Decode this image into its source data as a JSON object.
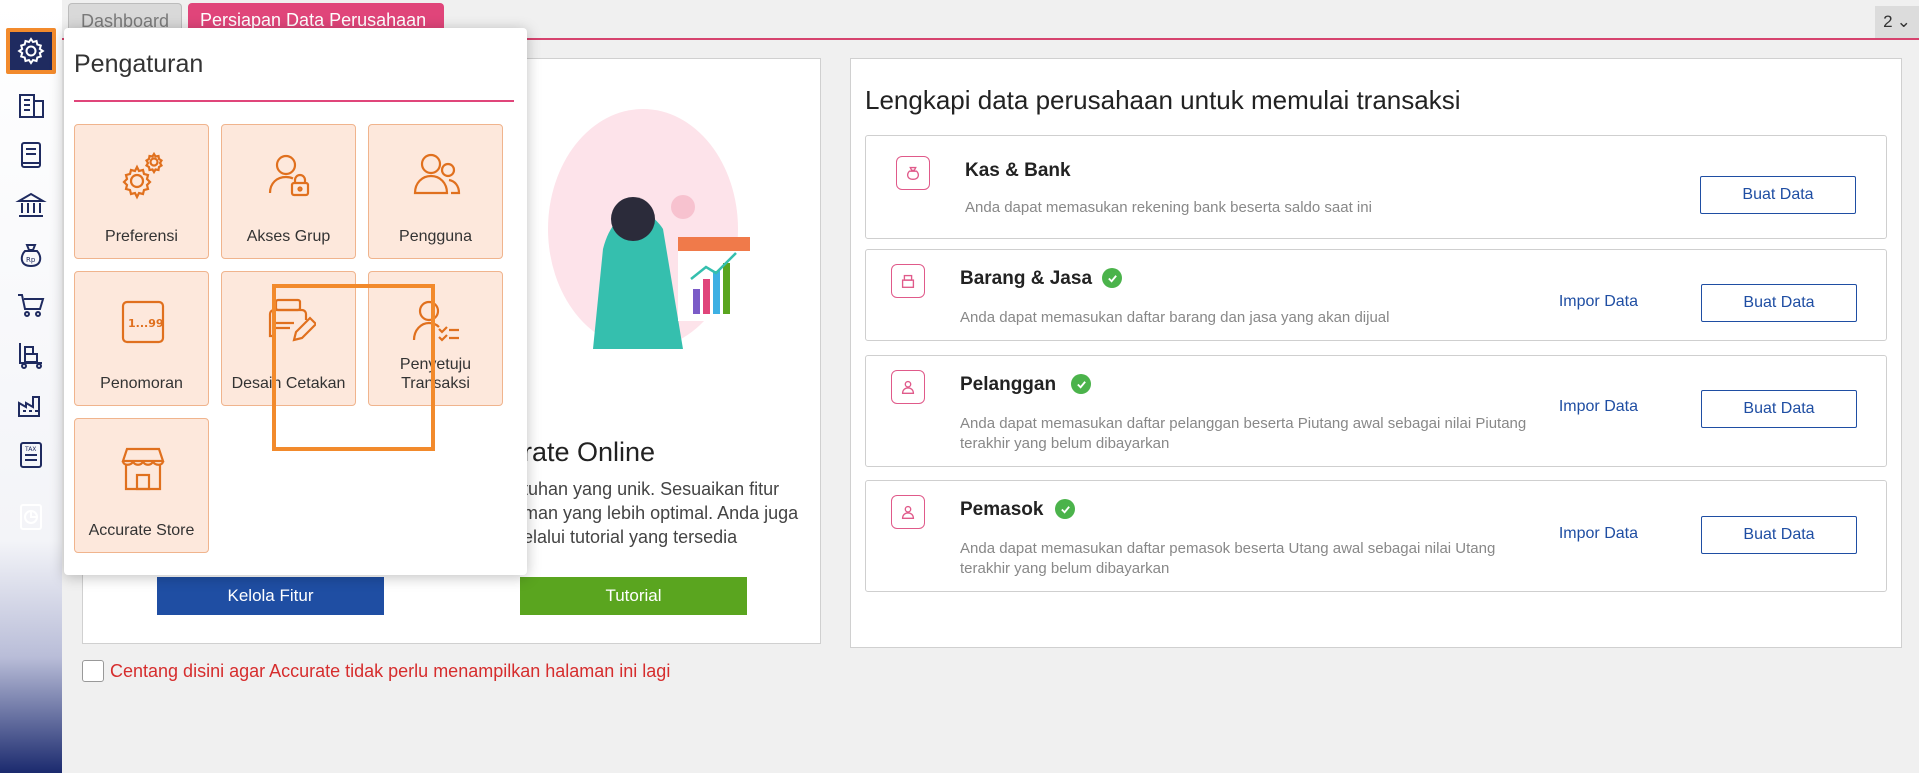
{
  "tabs": {
    "dashboard": "Dashboard",
    "persiapan": "Persiapan Data Perusahaan",
    "counter": "2"
  },
  "sidebar": {
    "items": [
      "settings",
      "company",
      "ledger",
      "bank",
      "sales-money",
      "cart",
      "inventory",
      "warehouse",
      "tax",
      "reports"
    ]
  },
  "welcome": {
    "title": "rate Online",
    "desc_line1": "tuhan yang unik. Sesuaikan fitur",
    "desc_line2": "man yang lebih optimal. Anda juga",
    "desc_line3": "elalui tutorial yang tersedia",
    "kelola_label": "Kelola Fitur",
    "tutorial_label": "Tutorial"
  },
  "dont_show": "Centang disini agar Accurate tidak perlu menampilkan halaman ini lagi",
  "right": {
    "title": "Lengkapi data perusahaan untuk memulai transaksi",
    "cards": [
      {
        "title": "Kas & Bank",
        "desc": "Anda dapat memasukan rekening bank beserta saldo saat ini",
        "done": false,
        "buat": "Buat Data"
      },
      {
        "title": "Barang & Jasa",
        "desc": "Anda dapat memasukan daftar barang dan jasa yang akan dijual",
        "done": true,
        "impor": "Impor Data",
        "buat": "Buat Data"
      },
      {
        "title": "Pelanggan",
        "desc": "Anda dapat memasukan daftar pelanggan beserta Piutang awal sebagai nilai Piutang terakhir yang belum dibayarkan",
        "done": true,
        "impor": "Impor Data",
        "buat": "Buat Data"
      },
      {
        "title": "Pemasok",
        "desc": "Anda dapat memasukan daftar pemasok beserta Utang awal sebagai nilai Utang terakhir yang belum dibayarkan",
        "done": true,
        "impor": "Impor Data",
        "buat": "Buat Data"
      }
    ]
  },
  "settings_menu": {
    "title": "Pengaturan",
    "tiles": [
      {
        "label": "Preferensi",
        "icon": "gears-icon"
      },
      {
        "label": "Akses Grup",
        "icon": "user-lock-icon"
      },
      {
        "label": "Pengguna",
        "icon": "users-icon"
      },
      {
        "label": "Penomoran",
        "icon": "numbering-icon",
        "icon_text": "1...99"
      },
      {
        "label": "Desain Cetakan",
        "icon": "printer-edit-icon"
      },
      {
        "label": "Penyetuju Transaksi",
        "icon": "user-approve-icon"
      },
      {
        "label": "Accurate Store",
        "icon": "store-icon"
      }
    ]
  },
  "colors": {
    "accent_pink": "#e0457a",
    "highlight_orange": "#f28a2c",
    "tile_bg": "#fde8dc",
    "primary_blue": "#1f4ea3",
    "green": "#5aa51f"
  }
}
